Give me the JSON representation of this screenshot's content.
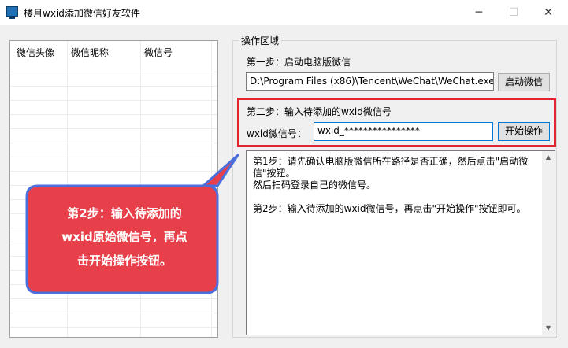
{
  "window": {
    "title": "楼月wxid添加微信好友软件",
    "minimize": "─",
    "maximize": "☐",
    "close": "✕"
  },
  "friend_list": {
    "columns": [
      "微信头像",
      "微信昵称",
      "微信号"
    ]
  },
  "operation": {
    "legend": "操作区域",
    "step1_label": "第一步：启动电脑版微信",
    "wechat_path": "D:\\Program Files (x86)\\Tencent\\WeChat\\WeChat.exe",
    "launch_button": "启动微信",
    "step2_label": "第二步：输入待添加的wxid微信号",
    "wxid_label": "wxid微信号：",
    "wxid_value": "wxid_****************",
    "start_button": "开始操作",
    "log": "第1步：请先确认电脑版微信所在路径是否正确，然后点击\"启动微信\"按钮。\n然后扫码登录自己的微信号。\n\n第2步：输入待添加的wxid微信号，再点击\"开始操作\"按钮即可。"
  },
  "callout": {
    "text": "第2步：输入待添加的wxid原始微信号，再点击开始操作按钮。",
    "line1": "第2步：输入待添加的",
    "line2": "wxid原始微信号，再点",
    "line3": "击开始操作按钮。",
    "fill_color": "#e8404a",
    "border_color": "#4a6fdc"
  },
  "colors": {
    "highlight": "#e3232e",
    "focus": "#0078d7"
  }
}
